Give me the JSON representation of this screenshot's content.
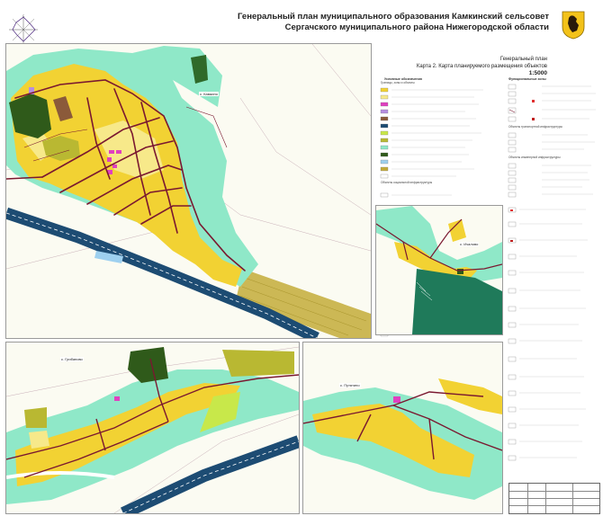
{
  "title": {
    "line1": "Генеральный план муниципального образования Камкинский сельсовет",
    "line2": "Сергачского муниципального района Нижегородской области"
  },
  "subtitle": {
    "line1": "Генеральный план",
    "line2": "Карта 2. Карта планируемого размещения объектов",
    "scale": "1:5000"
  },
  "places": {
    "kamkino": "с. Камкино",
    "ichalovo": "с. Ичалово",
    "gribanovo": "с. Грибаново",
    "putyatino": "с. Путятино"
  },
  "legend": {
    "left_heading": "Условные обозначения",
    "left_subheading": "Границы, зоны и объекты",
    "right_heading": "Функциональные зоны",
    "section_transport": "Объекты транспортной инфраструктуры",
    "section_engineering": "Объекты инженерной инфраструктуры",
    "section_social": "Объекты социальной инфраструктуры"
  },
  "colors": {
    "residential": "#f2d233",
    "residential_light": "#f7e98a",
    "green": "#8fe8c8",
    "forest": "#2f5a1a",
    "agricultural": "#c8b03c",
    "river": "#1d4c73",
    "road": "#7a1830",
    "industrial": "#8b5a3a",
    "public": "#e040c0",
    "lime": "#c8e84a"
  }
}
